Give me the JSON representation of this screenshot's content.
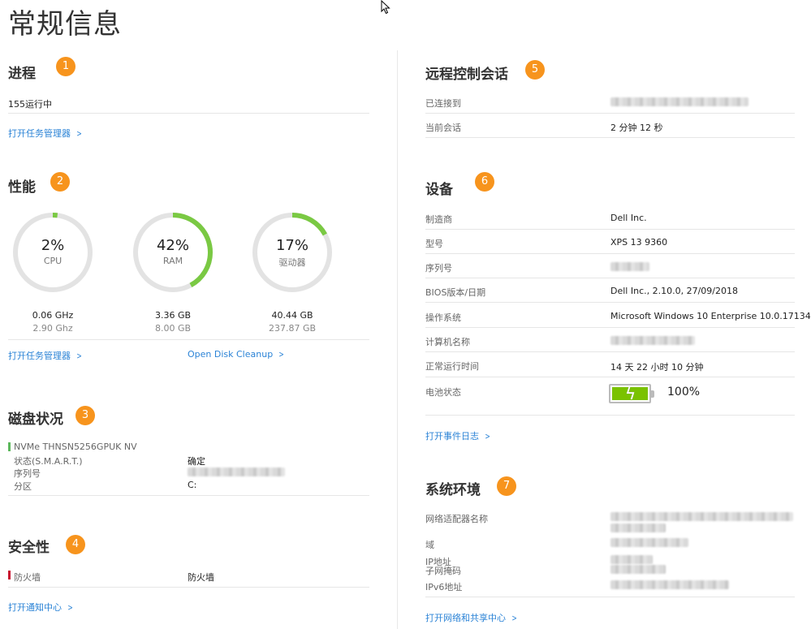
{
  "page": {
    "title": "常规信息"
  },
  "process": {
    "title": "进程",
    "badge": "1",
    "running": "155运行中",
    "link": "打开任务管理器"
  },
  "performance": {
    "title": "性能",
    "badge": "2",
    "gauges": [
      {
        "pct_label": "2%",
        "name": "CPU",
        "value": "0.06 GHz",
        "sub": "2.90 Ghz",
        "fraction": 0.02
      },
      {
        "pct_label": "42%",
        "name": "RAM",
        "value": "3.36 GB",
        "sub": "8.00 GB",
        "fraction": 0.42
      },
      {
        "pct_label": "17%",
        "name": "驱动器",
        "value": "40.44 GB",
        "sub": "237.87 GB",
        "fraction": 0.17
      }
    ],
    "link_task": "打开任务管理器",
    "link_disk": "Open Disk Cleanup",
    "colors": {
      "track": "#e3e3e3",
      "fill": "#7ac943"
    }
  },
  "disk": {
    "title": "磁盘状况",
    "badge": "3",
    "drive": "NVMe THNSN5256GPUK NV",
    "rows": [
      {
        "label": "状态(S.M.A.R.T.)",
        "value": "确定"
      },
      {
        "label": "序列号",
        "value": ""
      },
      {
        "label": "分区",
        "value": "C:"
      }
    ]
  },
  "security": {
    "title": "安全性",
    "badge": "4",
    "label": "防火墙",
    "value": "防火墙",
    "link": "打开通知中心"
  },
  "remote": {
    "title": "远程控制会话",
    "badge": "5",
    "rows": [
      {
        "label": "已连接到",
        "value": ""
      },
      {
        "label": "当前会话",
        "value": "2 分钟 12 秒"
      }
    ]
  },
  "device": {
    "title": "设备",
    "badge": "6",
    "rows": [
      {
        "label": "制造商",
        "value": "Dell Inc."
      },
      {
        "label": "型号",
        "value": "XPS 13 9360"
      },
      {
        "label": "序列号",
        "value": ""
      },
      {
        "label": "BIOS版本/日期",
        "value": "Dell Inc., 2.10.0, 27/09/2018"
      },
      {
        "label": "操作系统",
        "value": "Microsoft Windows 10 Enterprise 10.0.17134"
      },
      {
        "label": "计算机名称",
        "value": ""
      },
      {
        "label": "正常运行时间",
        "value": "14 天 22 小时 10 分钟"
      },
      {
        "label": "电池状态",
        "value": "100%"
      }
    ],
    "battery_level": 1.0,
    "link": "打开事件日志"
  },
  "system": {
    "title": "系统环境",
    "badge": "7",
    "rows": [
      {
        "label": "网络适配器名称"
      },
      {
        "label": "域"
      },
      {
        "label": "IP地址"
      },
      {
        "label": "子网掩码"
      },
      {
        "label": "IPv6地址"
      }
    ],
    "link": "打开网络和共享中心"
  },
  "icons": {
    "chevron": "chevron-right-icon",
    "cursor": "mouse-cursor-icon",
    "battery": "battery-charging-icon"
  }
}
